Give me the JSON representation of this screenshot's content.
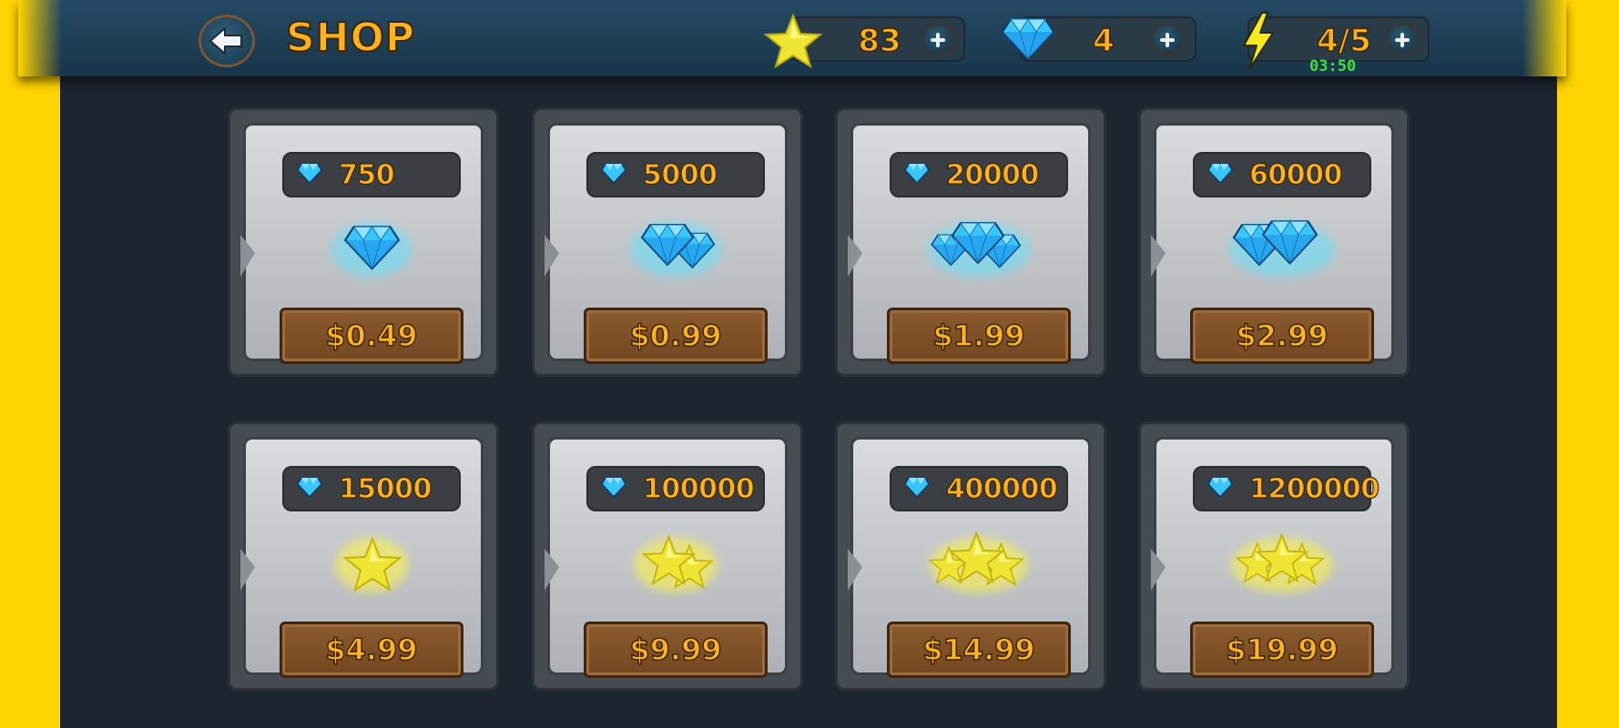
{
  "header": {
    "title": "SHOP",
    "back_icon": "back-arrow-icon",
    "stars": "83",
    "gems": "4",
    "energy": "4/5",
    "energy_timer": "03:50"
  },
  "colors": {
    "accent_text": "#ffb21c",
    "timer": "#3ee03a",
    "page_border": "#ffd400",
    "background": "#1c2530",
    "gem": "#38c6ff",
    "star": "#f3e83a",
    "price_wood": "#8b5a2e"
  },
  "products": [
    {
      "currency": "gem",
      "amount": "750",
      "price": "$0.49",
      "icon": "gem-icon"
    },
    {
      "currency": "gem",
      "amount": "5000",
      "price": "$0.99",
      "icon": "gem-pair-icon"
    },
    {
      "currency": "gem",
      "amount": "20000",
      "price": "$1.99",
      "icon": "gem-pile-icon"
    },
    {
      "currency": "gem",
      "amount": "60000",
      "price": "$2.99",
      "icon": "gem-stack-icon"
    },
    {
      "currency": "gem",
      "amount": "15000",
      "price": "$4.99",
      "icon": "star-icon"
    },
    {
      "currency": "gem",
      "amount": "100000",
      "price": "$9.99",
      "icon": "star-pair-icon"
    },
    {
      "currency": "gem",
      "amount": "400000",
      "price": "$14.99",
      "icon": "star-pile-icon"
    },
    {
      "currency": "gem",
      "amount": "1200000",
      "price": "$19.99",
      "icon": "star-stack-icon"
    }
  ]
}
